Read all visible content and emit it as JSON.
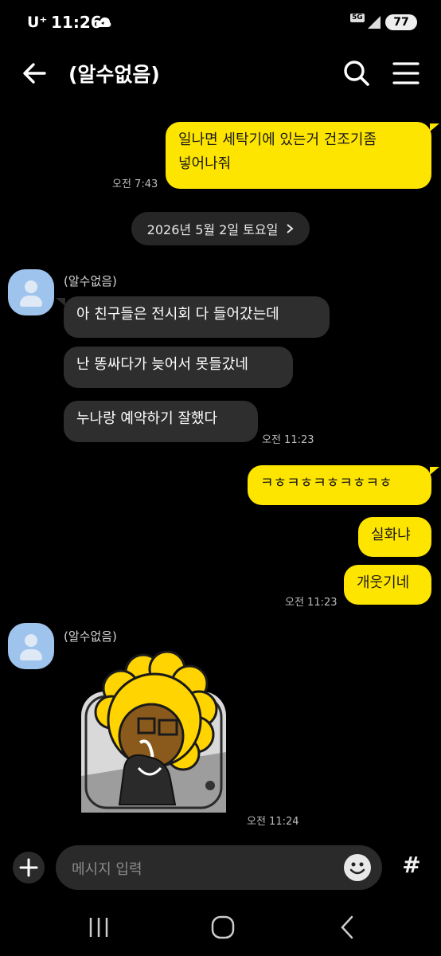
{
  "status_bar": {
    "carrier": "U⁺",
    "time": "11:26",
    "network": "5G",
    "battery": "77"
  },
  "header": {
    "title": "(알수없음)"
  },
  "messages": {
    "m1": {
      "text_line1": "일나면 세탁기에 있는거 건조기좀",
      "text_line2": "넣어나줘",
      "time": "오전 7:43"
    },
    "date_divider": "2026년 5월 2일 토요일",
    "sender1": "(알수없음)",
    "m2": "아 친구들은 전시회 다 들어갔는데",
    "m3": "난 똥싸다가 늦어서 못들갔네",
    "m4": "누나랑 예약하기 잘했다",
    "m4_time": "오전 11:23",
    "m5": "ㅋㅎㅋㅎㅋㅎㅋㅎㅋㅎ",
    "m6": "실화냐",
    "m7": "개웃기네",
    "m7_time": "오전 11:23",
    "sender2": "(알수없음)",
    "sticker_time": "오전 11:24"
  },
  "input": {
    "placeholder": "메시지 입력",
    "hash_label": "#"
  },
  "colors": {
    "bubble_out": "#fee500",
    "bubble_in": "#2e2e2e",
    "background": "#000000"
  }
}
